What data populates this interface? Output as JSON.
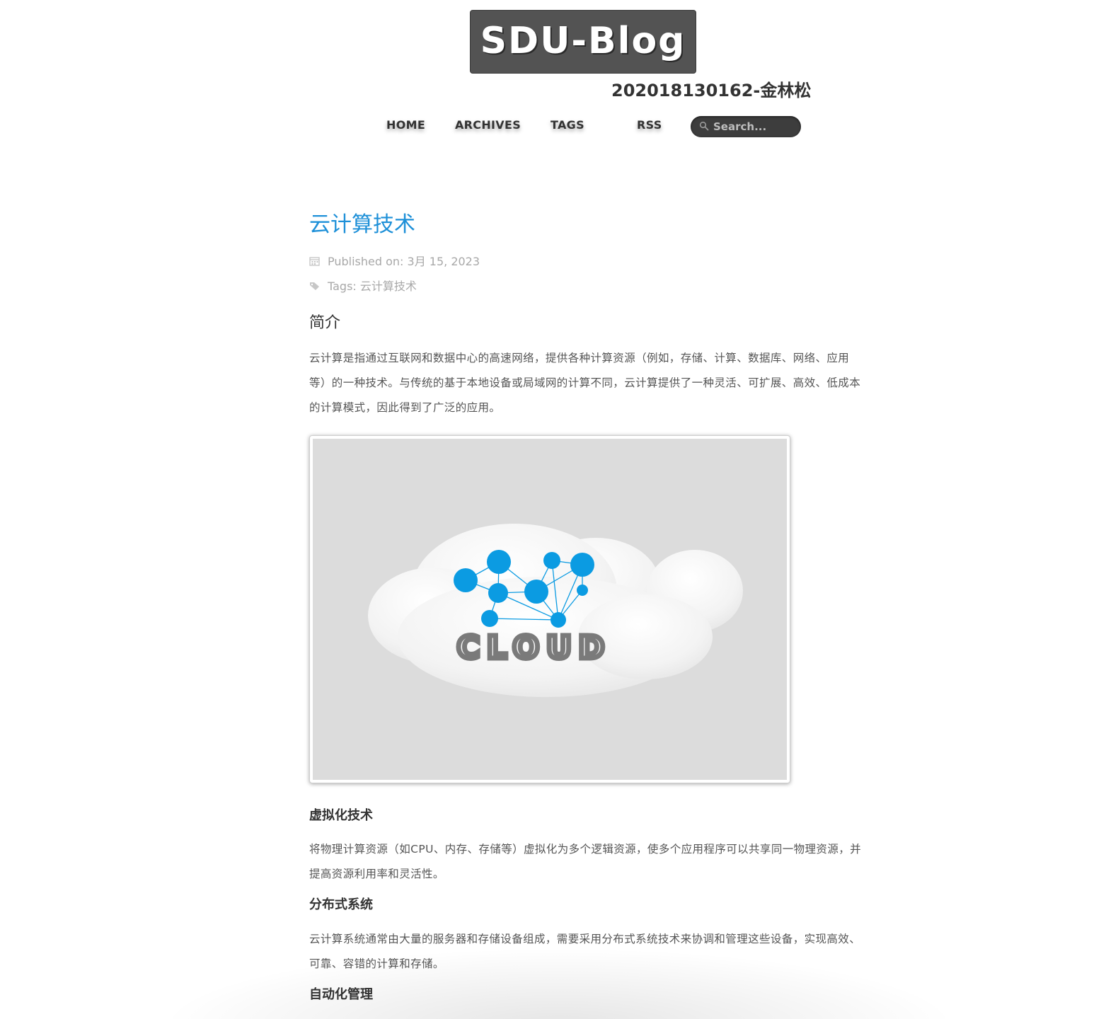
{
  "header": {
    "logo_text": "SDU-Blog",
    "subtitle": "202018130162-金林松"
  },
  "nav": {
    "items": [
      "HOME",
      "ARCHIVES",
      "TAGS",
      "RSS"
    ],
    "search_placeholder": "Search..."
  },
  "post": {
    "title": "云计算技术",
    "published_on": "Published on: 3月 15, 2023",
    "tags_prefix": "Tags: ",
    "tag": "云计算技术",
    "section_title": "简介",
    "intro": "云计算是指通过互联网和数据中心的高速网络，提供各种计算资源（例如，存储、计算、数据库、网络、应用等）的一种技术。与传统的基于本地设备或局域网的计算不同，云计算提供了一种灵活、可扩展、高效、低成本的计算模式，因此得到了广泛的应用。",
    "figure": {
      "caption_text": "CLOUD",
      "accent_color": "#0b9be2",
      "background_color": "#dcdcdc"
    },
    "subsections": [
      {
        "heading": "虚拟化技术",
        "text": "将物理计算资源（如CPU、内存、存储等）虚拟化为多个逻辑资源，使多个应用程序可以共享同一物理资源，并提高资源利用率和灵活性。"
      },
      {
        "heading": "分布式系统",
        "text": "云计算系统通常由大量的服务器和存储设备组成，需要采用分布式系统技术来协调和管理这些设备，实现高效、可靠、容错的计算和存储。"
      },
      {
        "heading": "自动化管理",
        "text": ""
      }
    ]
  },
  "colors": {
    "title_link": "#1e90d8",
    "logo_bg": "#535353",
    "search_bg": "#3d3d3d"
  }
}
